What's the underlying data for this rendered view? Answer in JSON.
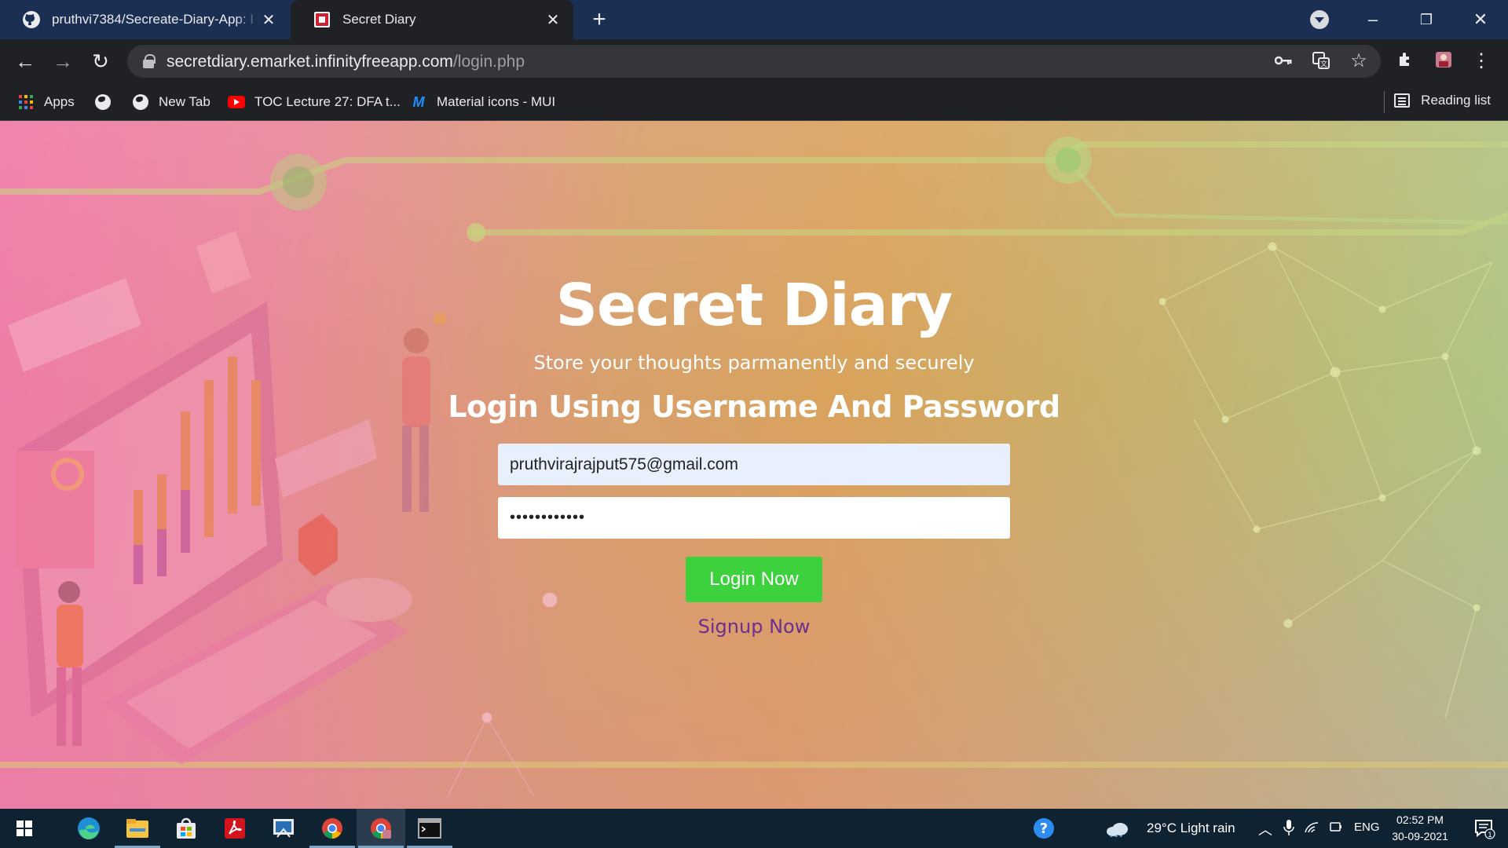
{
  "browser": {
    "tabs": [
      {
        "title": "pruthvi7384/Secreate-Diary-App: I h",
        "favicon": "github-icon",
        "active": false
      },
      {
        "title": "Secret Diary",
        "favicon": "secret-diary-favicon",
        "active": true
      }
    ],
    "address": {
      "domain": "secretdiary.emarket.infinityfreeapp.com",
      "path": "/login.php"
    },
    "bookmarks": [
      {
        "label": "Apps",
        "icon": "apps-grid-icon"
      },
      {
        "label": "",
        "icon": "globe-icon"
      },
      {
        "label": "New Tab",
        "icon": "globe-icon"
      },
      {
        "label": "TOC Lecture 27: DFA t...",
        "icon": "youtube-icon"
      },
      {
        "label": "Material icons - MUI",
        "icon": "mui-icon"
      }
    ],
    "reading_list": "Reading list"
  },
  "page": {
    "title": "Secret Diary",
    "tagline": "Store your thoughts parmanently and securely",
    "subtitle": "Login Using Username And Password",
    "email_value": "pruthvirajrajput575@gmail.com",
    "password_value": "••••••••••••",
    "login_label": "Login Now",
    "signup_label": "Signup Now"
  },
  "taskbar": {
    "weather": "29°C  Light rain",
    "language": "ENG",
    "time": "02:52 PM",
    "date": "30-09-2021",
    "notification_count": "1"
  },
  "colors": {
    "tab_strip": "#1b2f52",
    "toolbar": "#202124",
    "login_button": "#3dd13d",
    "signup_link": "#6b2f8f",
    "email_autofill": "#e8f0fe"
  }
}
